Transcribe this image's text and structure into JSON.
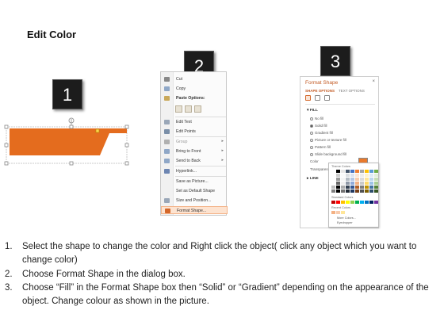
{
  "title": "Edit Color",
  "steps": [
    "1",
    "2",
    "3"
  ],
  "colors": {
    "shape_orange": "#e46c1e",
    "badge_bg": "#1c1c1c",
    "menu_highlight": "#fde3d0",
    "pane_accent": "#c35a23"
  },
  "context_menu": {
    "items": [
      {
        "label": "Cut",
        "icon": "scissors-icon",
        "color": "#888888"
      },
      {
        "label": "Copy",
        "icon": "copy-icon",
        "color": "#8fa7c7"
      },
      {
        "label": "Paste Options:",
        "icon": "clipboard-icon",
        "color": "#c9a85a"
      },
      {
        "label": "Edit Text",
        "icon": "edit-text-icon",
        "color": "#9aa7b8"
      },
      {
        "label": "Edit Points",
        "icon": "edit-points-icon",
        "color": "#7a8fa8"
      },
      {
        "label": "Group",
        "icon": "group-icon",
        "color": "#b0b0b0"
      },
      {
        "label": "Bring to Front",
        "icon": "bring-front-icon",
        "color": "#8fa7c7"
      },
      {
        "label": "Send to Back",
        "icon": "send-back-icon",
        "color": "#8fa7c7"
      },
      {
        "label": "Hyperlink...",
        "icon": "hyperlink-icon",
        "color": "#6d86b2"
      },
      {
        "label": "Save as Picture...",
        "icon": "",
        "color": ""
      },
      {
        "label": "Set as Default Shape",
        "icon": "",
        "color": ""
      },
      {
        "label": "Size and Position...",
        "icon": "size-position-icon",
        "color": "#9aa7b8"
      },
      {
        "label": "Format Shape...",
        "icon": "format-shape-icon",
        "color": "#d4682b"
      }
    ]
  },
  "format_pane": {
    "title": "Format Shape",
    "close": "×",
    "tab_shape": "SHAPE OPTIONS",
    "tab_text": "TEXT OPTIONS",
    "fill_section": "FILL",
    "fill_options": [
      "No fill",
      "Solid fill",
      "Gradient fill",
      "Picture or texture fill",
      "Pattern fill",
      "Slide background fill"
    ],
    "color_label": "Color",
    "transparency_label": "Transparency",
    "line_section": "LINE"
  },
  "palette": {
    "theme_label": "Theme Colors",
    "standard_label": "Standard Colors",
    "recent_label": "Recent Colors",
    "more_colors": "More Colors...",
    "eyedropper": "Eyedropper",
    "theme_top": [
      "#ffffff",
      "#000000",
      "#e7e6e6",
      "#44546a",
      "#4472c4",
      "#ed7d31",
      "#a5a5a5",
      "#ffc000",
      "#5b9bd5",
      "#70ad47"
    ],
    "standard": [
      "#c00000",
      "#ff0000",
      "#ffc000",
      "#ffff00",
      "#92d050",
      "#00b050",
      "#00b0f0",
      "#0070c0",
      "#002060",
      "#7030a0"
    ],
    "recent": [
      "#f4b183",
      "#f8cbad",
      "#ffe699"
    ]
  },
  "instructions": [
    {
      "num": "1.",
      "text": "Select the shape to change the color and Right click the object( click any object which you want to change color)"
    },
    {
      "num": "2.",
      "text": "Choose Format Shape in the dialog box."
    },
    {
      "num": "3.",
      "text": "Choose “Fill” in the Format Shape box then “Solid” or “Gradient” depending on the appearance of the object. Change colour as shown in the picture."
    }
  ]
}
